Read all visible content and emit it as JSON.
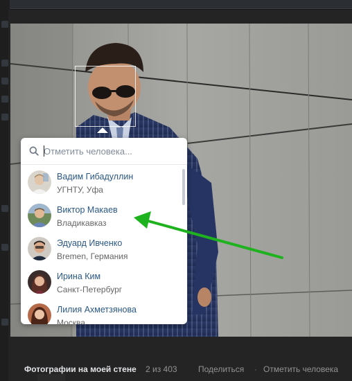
{
  "search": {
    "placeholder": "Отметить человека..."
  },
  "friends": [
    {
      "name": "Вадим Гибадуллин",
      "subtitle": "УГНТУ, Уфа"
    },
    {
      "name": "Виктор Макаев",
      "subtitle": "Владикавказ"
    },
    {
      "name": "Эдуард Ивченко",
      "subtitle": "Bremen, Германия"
    },
    {
      "name": "Ирина Ким",
      "subtitle": "Санкт-Петербург"
    },
    {
      "name": "Лилия Ахметзянова",
      "subtitle": "Москва"
    }
  ],
  "footer": {
    "album_title": "Фотографии на моей стене",
    "counter": "2 из 403",
    "share_label": "Поделиться",
    "separator": "·",
    "tag_label": "Отметить человека"
  },
  "colors": {
    "link": "#2a5885",
    "arrow": "#1fb21f",
    "panel_bg": "#242424"
  }
}
